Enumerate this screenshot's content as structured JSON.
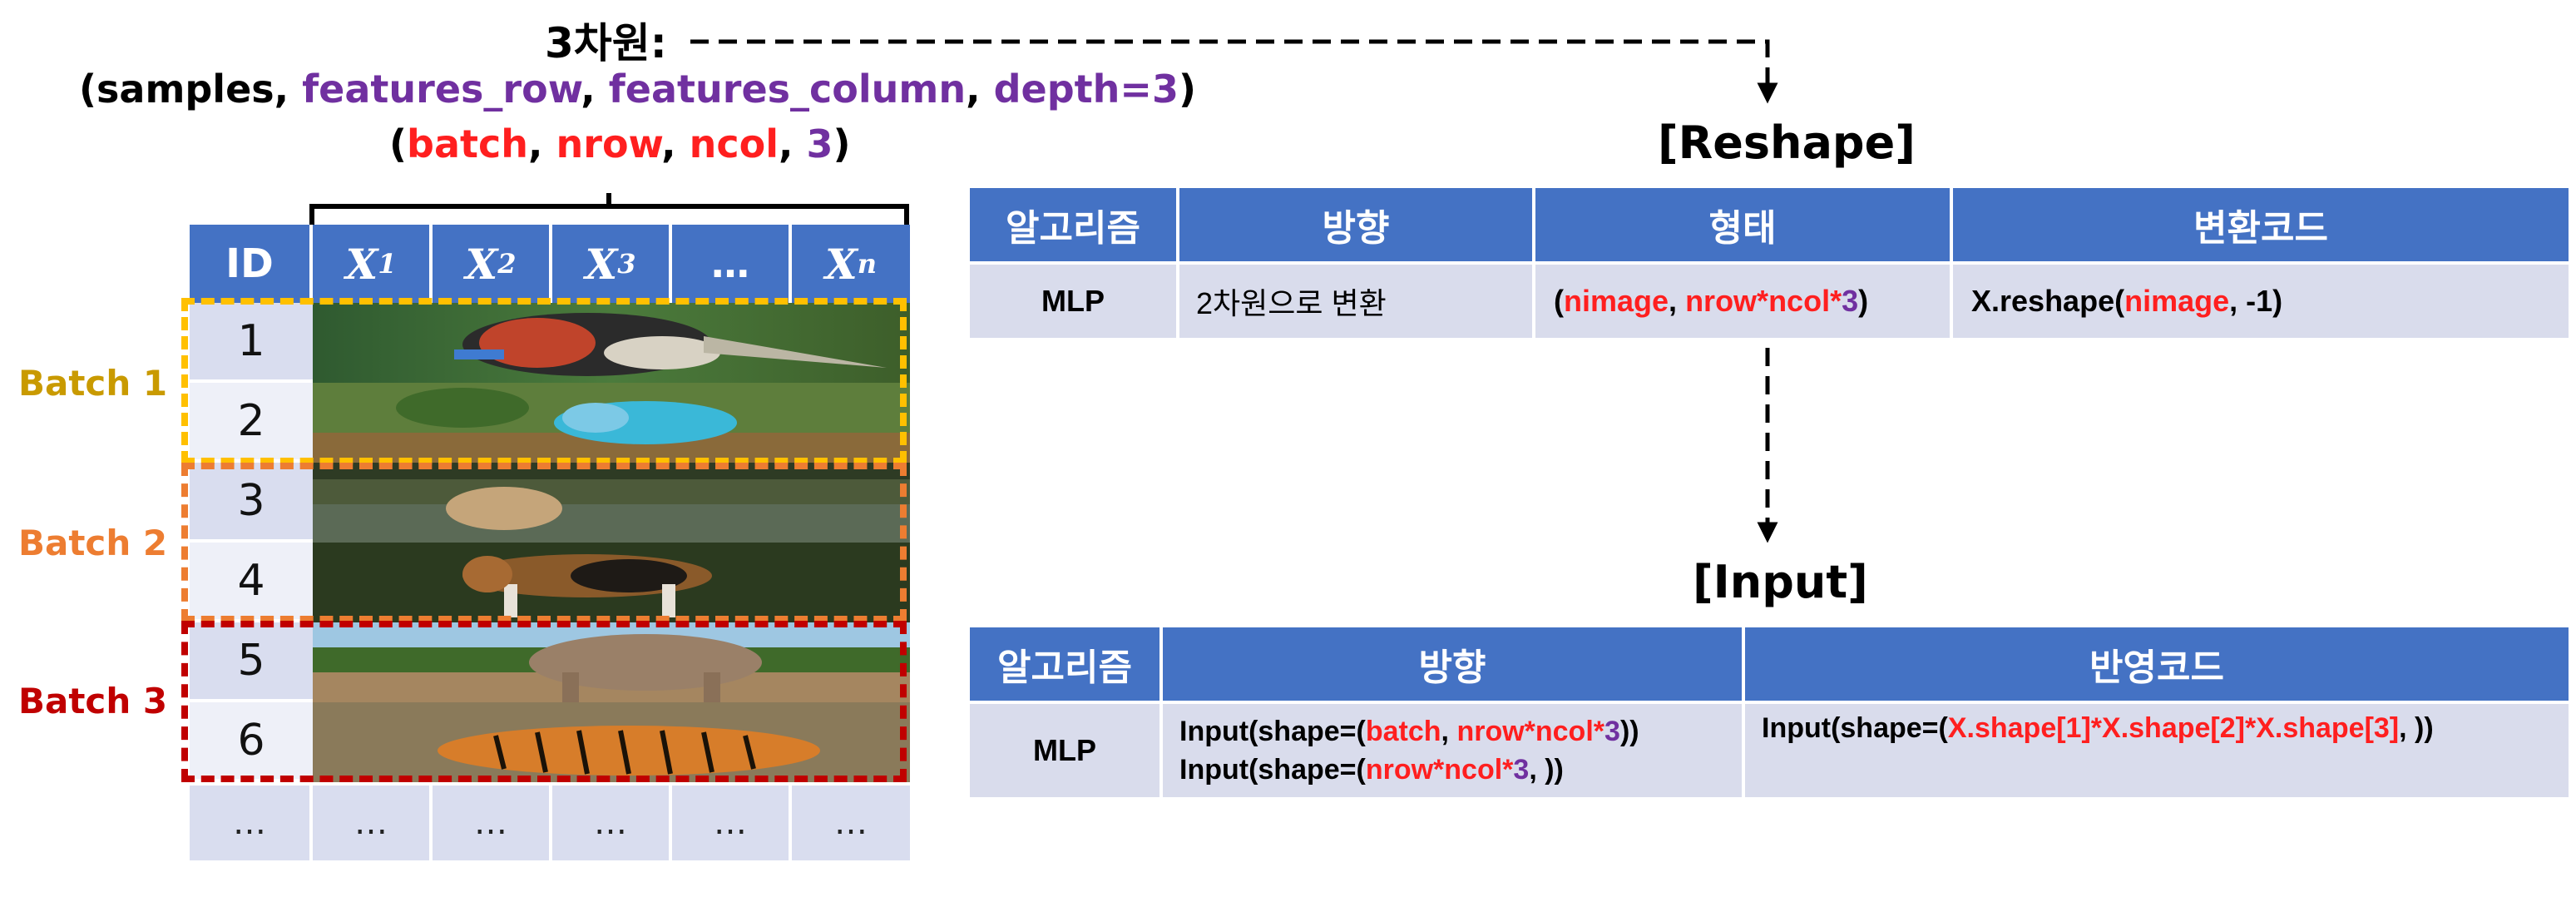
{
  "shape_header": {
    "title": "3차원:",
    "line1": {
      "open": "(",
      "samples": "samples",
      "sep1": ", ",
      "features_row": "features_row",
      "sep2": ", ",
      "features_column": "features_column",
      "sep3": ", ",
      "depth": "depth=3",
      "close": ")"
    },
    "line2": {
      "open": "(",
      "batch": "batch",
      "sep1": ", ",
      "nrow": "nrow",
      "sep2": ", ",
      "ncol": "ncol",
      "sep3": ", ",
      "three": "3",
      "close": ")"
    }
  },
  "left_table": {
    "headers": [
      "ID",
      "X",
      "X",
      "X",
      "…",
      "X"
    ],
    "subscripts": [
      "",
      "1",
      "2",
      "3",
      "",
      "n"
    ],
    "ids": [
      "1",
      "2",
      "3",
      "4",
      "5",
      "6"
    ],
    "footer": [
      "…",
      "…",
      "…",
      "…",
      "…",
      "…"
    ],
    "image_names": [
      "bird-image",
      "parakeet-image",
      "dog-water-image",
      "beagle-image",
      "elephant-image",
      "tiger-image"
    ]
  },
  "batches": [
    {
      "label": "Batch 1",
      "color": "#ffc000"
    },
    {
      "label": "Batch 2",
      "color": "#ed7d31"
    },
    {
      "label": "Batch 3",
      "color": "#c00000"
    }
  ],
  "reshape": {
    "title": "[Reshape]",
    "headers": [
      "알고리즘",
      "방향",
      "형태",
      "변환코드"
    ],
    "row": {
      "algorithm": "MLP",
      "direction": "2차원으로 변환",
      "form": {
        "open": "(",
        "a": "nimage",
        "sep": ", ",
        "b": "nrow*ncol*",
        "c": "3",
        "close": ")"
      },
      "code": {
        "pre": "X.reshape(",
        "a": "nimage",
        "post": ", -1)"
      }
    }
  },
  "input": {
    "title": "[Input]",
    "headers": [
      "알고리즘",
      "방향",
      "반영코드"
    ],
    "row": {
      "algorithm": "MLP",
      "dir1": {
        "pre": "Input(shape=(",
        "a": "batch",
        "sep": ", ",
        "b": "nrow*ncol*",
        "c": "3",
        "post": "))"
      },
      "dir2": {
        "pre": "Input(shape=(",
        "b": "nrow*ncol*",
        "c": "3",
        "post": ", ))"
      },
      "code": {
        "pre": "Input(shape=(",
        "a": "X.shape[1]*X.shape[2]*X.shape[3]",
        "post": ", ))"
      }
    }
  },
  "colors": {
    "header_bg": "#4472c4",
    "cell_bg": "#d9dcec",
    "red": "#ff1f1f",
    "purple": "#7030a0"
  }
}
